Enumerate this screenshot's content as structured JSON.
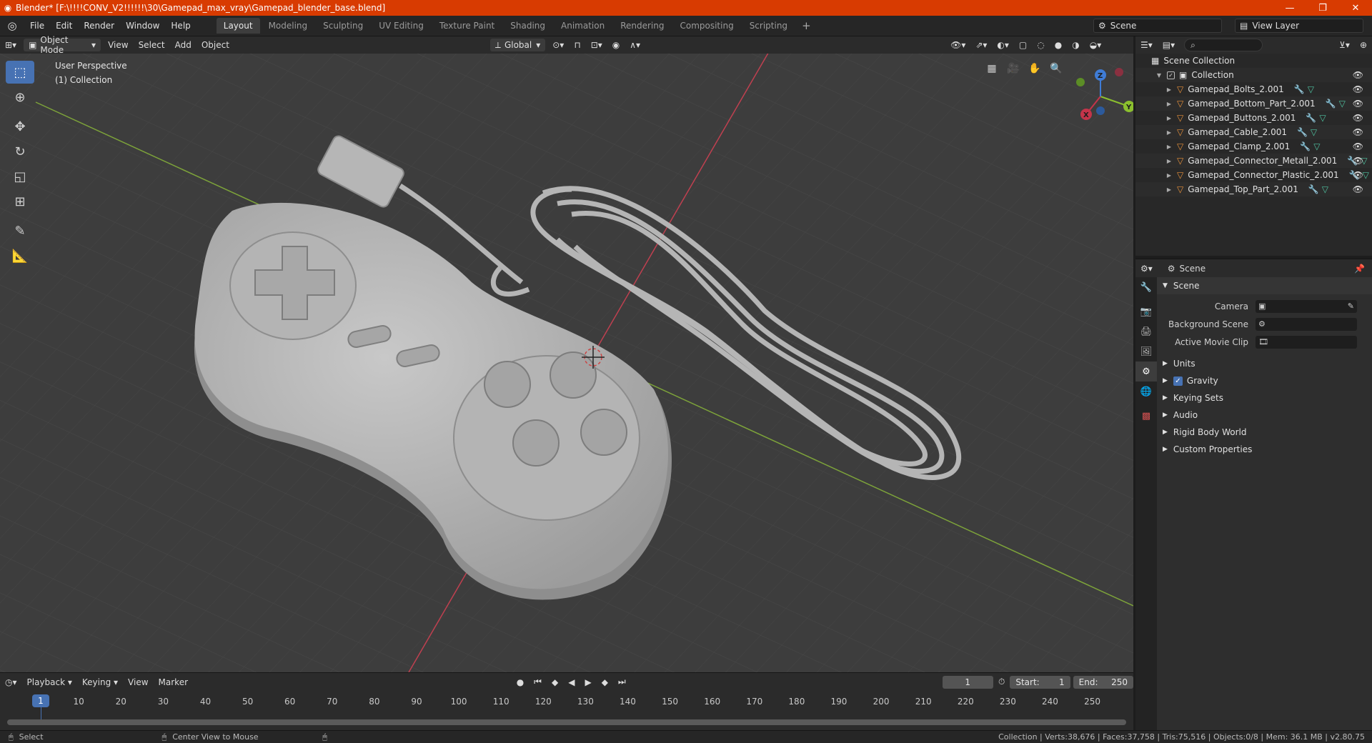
{
  "titlebar": {
    "title": "Blender* [F:\\!!!!CONV_V2!!!!!!\\30\\Gamepad_max_vray\\Gamepad_blender_base.blend]",
    "min": "—",
    "max": "❐",
    "close": "✕"
  },
  "menu": {
    "items": [
      "File",
      "Edit",
      "Render",
      "Window",
      "Help"
    ]
  },
  "workspaces": {
    "tabs": [
      "Layout",
      "Modeling",
      "Sculpting",
      "UV Editing",
      "Texture Paint",
      "Shading",
      "Animation",
      "Rendering",
      "Compositing",
      "Scripting"
    ],
    "active": "Layout",
    "add": "+"
  },
  "scene": {
    "label": "Scene",
    "view_layer": "View Layer"
  },
  "viewport_header": {
    "mode": "Object Mode",
    "menus": [
      "View",
      "Select",
      "Add",
      "Object"
    ],
    "transform": "Global"
  },
  "viewport": {
    "perspective": "User Perspective",
    "collection": "(1) Collection"
  },
  "gizmo": {
    "x": "X",
    "y": "Y",
    "z": "Z"
  },
  "timeline_header": {
    "menus": [
      "Playback",
      "Keying",
      "View",
      "Marker"
    ],
    "current_frame": "1",
    "start_label": "Start:",
    "start": "1",
    "end_label": "End:",
    "end": "250"
  },
  "timeline": {
    "ticks": [
      "1",
      "10",
      "20",
      "30",
      "40",
      "50",
      "60",
      "70",
      "80",
      "90",
      "100",
      "110",
      "120",
      "130",
      "140",
      "150",
      "160",
      "170",
      "180",
      "190",
      "200",
      "210",
      "220",
      "230",
      "240",
      "250"
    ]
  },
  "statusbar": {
    "select": "Select",
    "center": "Center View to Mouse",
    "stats": "Collection | Verts:38,676 | Faces:37,758 | Tris:75,516 | Objects:0/8 | Mem: 36.1 MB | v2.80.75"
  },
  "outliner": {
    "scene_collection": "Scene Collection",
    "collection": "Collection",
    "objects": [
      "Gamepad_Bolts_2.001",
      "Gamepad_Bottom_Part_2.001",
      "Gamepad_Buttons_2.001",
      "Gamepad_Cable_2.001",
      "Gamepad_Clamp_2.001",
      "Gamepad_Connector_Metall_2.001",
      "Gamepad_Connector_Plastic_2.001",
      "Gamepad_Top_Part_2.001"
    ]
  },
  "properties": {
    "header": "Scene",
    "panel": "Scene",
    "camera_label": "Camera",
    "bg_label": "Background Scene",
    "clip_label": "Active Movie Clip",
    "sections": [
      "Units",
      "Gravity",
      "Keying Sets",
      "Audio",
      "Rigid Body World",
      "Custom Properties"
    ]
  },
  "colors": {
    "accent": "#4772b3",
    "titlebar": "#d83b01",
    "x_axis": "#c4344a",
    "y_axis": "#8bbf2e",
    "z_axis": "#3f7cd6"
  }
}
